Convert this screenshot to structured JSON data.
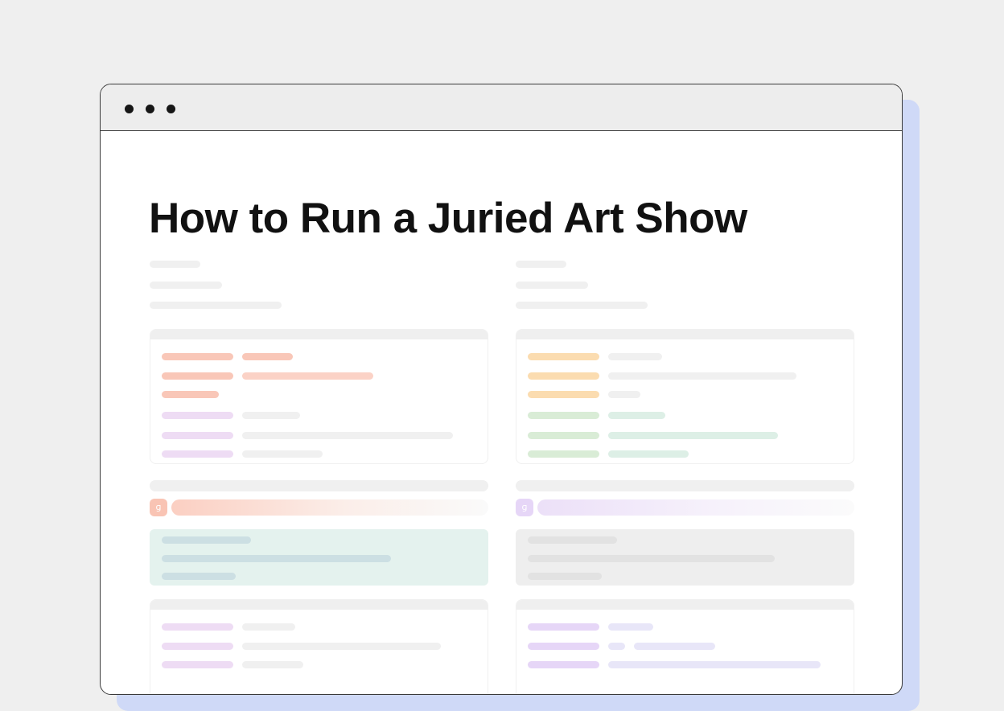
{
  "page": {
    "title": "How to Run a Juried Art Show"
  },
  "window": {
    "controls": [
      "window-dot",
      "window-dot",
      "window-dot"
    ]
  },
  "left_column": {
    "step_badge": "ɡ",
    "accent_color": "#f9c4b4"
  },
  "right_column": {
    "step_badge": "ɡ",
    "accent_color": "#e6d6f7"
  },
  "colors": {
    "background": "#efefef",
    "window_border": "#3a3a3a",
    "shadow_panel": "#cfd9f7",
    "placeholder": "#efefef",
    "salmon": "#f9c7b8",
    "lavender": "#eedcf4",
    "orange": "#fbdcb0",
    "green": "#d9ecd6",
    "mint": "#ddefe6",
    "callout_green": "#e4f2ee",
    "callout_gray": "#eeeeee"
  }
}
